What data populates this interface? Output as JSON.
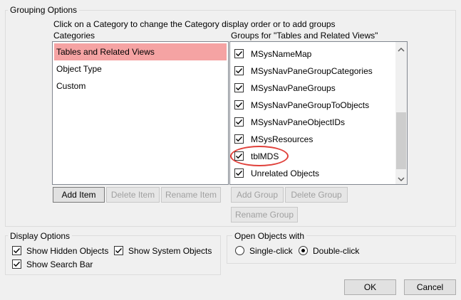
{
  "grouping": {
    "title": "Grouping Options",
    "instruction": "Click on a Category to change the Category display order or to add groups",
    "categories_header": "Categories",
    "groups_header": "Groups for \"Tables and Related Views\"",
    "categories": [
      {
        "label": "Tables and Related Views",
        "selected": true
      },
      {
        "label": "Object Type",
        "selected": false
      },
      {
        "label": "Custom",
        "selected": false
      }
    ],
    "groups": [
      {
        "label": "MSysNameMap",
        "checked": true
      },
      {
        "label": "MSysNavPaneGroupCategories",
        "checked": true
      },
      {
        "label": "MSysNavPaneGroups",
        "checked": true
      },
      {
        "label": "MSysNavPaneGroupToObjects",
        "checked": true
      },
      {
        "label": "MSysNavPaneObjectIDs",
        "checked": true
      },
      {
        "label": "MSysResources",
        "checked": true
      },
      {
        "label": "tblMDS",
        "checked": true
      },
      {
        "label": "Unrelated Objects",
        "checked": true
      }
    ],
    "buttons": {
      "add_item": "Add Item",
      "delete_item": "Delete Item",
      "rename_item": "Rename Item",
      "add_group": "Add Group",
      "delete_group": "Delete Group",
      "rename_group": "Rename Group"
    }
  },
  "display": {
    "title": "Display Options",
    "show_hidden": {
      "label": "Show Hidden Objects",
      "checked": true
    },
    "show_system": {
      "label": "Show System Objects",
      "checked": true
    },
    "show_search": {
      "label": "Show Search Bar",
      "checked": true
    }
  },
  "open_objects": {
    "title": "Open Objects with",
    "single_click": {
      "label": "Single-click",
      "selected": false
    },
    "double_click": {
      "label": "Double-click",
      "selected": true
    }
  },
  "dialog_buttons": {
    "ok": "OK",
    "cancel": "Cancel"
  },
  "colors": {
    "selected_category": "#f5a3a3",
    "highlight_ring": "#e0403a"
  }
}
